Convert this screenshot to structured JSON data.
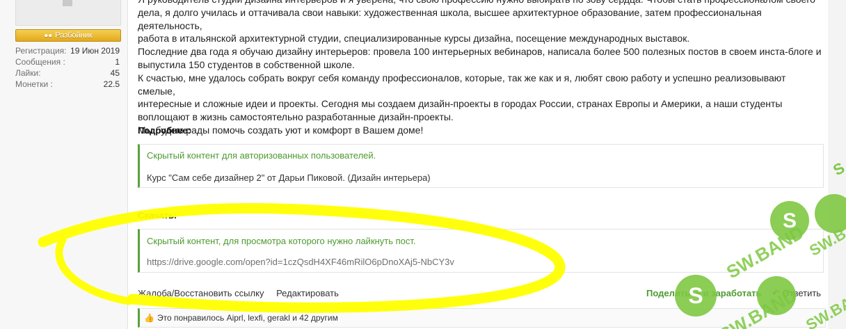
{
  "user": {
    "rank": "Разбойник",
    "stats": [
      {
        "label": "Регистрация:",
        "value": "19 Июн 2019"
      },
      {
        "label": "Сообщения :",
        "value": "1"
      },
      {
        "label": "Лайки:",
        "value": "45"
      },
      {
        "label": "Монетки :",
        "value": "22.5"
      }
    ]
  },
  "post": {
    "lines": [
      "Я руководитель студии дизайна интерьеров и я уверена, что свою профессию нужно выбирать по зову сердца. Чтобы стать профессионалом своего",
      "дела, я долго училась и оттачивала свои навыки: художественная школа, высшее архитектурное образование, затем профессиональная деятельность,",
      "работа в итальянской архитектурной студии, специализированные курсы дизайна, посещение международных выставок.",
      "Последние два года я обучаю дизайну интерьеров: провела 100 интерьерных вебинаров, написала более 500 полезных постов в своем инста-блоге и",
      "выпустила 150 студентов в собственной школе.",
      "К счастью, мне удалось собрать вокруг себя команду профессионалов, которые, так же как и я, любят свою работу и успешно реализовывают смелые,",
      "интересные и сложные идеи и проекты. Сегодня мы создаем дизайн-проекты в городах России, странах Европы и Америки, а наши студенты",
      "воплощают в жизнь самостоятельно разработанные дизайн-проекты.",
      "Мы будем рады помочь создать уют и комфорт в Вашем доме!"
    ],
    "details_heading": "Подробнее:",
    "hidden_auth": "Скрытый контент для авторизованных пользователей.",
    "course_title": "Курс \"Сам себе дизайнер 2\" от Дарьи Пиковой. (Дизайн интерьера)",
    "download_heading": "Скачать:",
    "hidden_like": "Скрытый контент, для просмотра которого нужно лайкнуть пост.",
    "download_link": "https://drive.google.com/open?id=1czQsdH4XF46mRilO6pDnoXAj5-NbCY3v"
  },
  "actions": {
    "report": "Жалоба/Восстановить ссылку",
    "edit": "Редактировать",
    "share": "Поделиться и заработать",
    "reply": "Ответить"
  },
  "likes": {
    "text": "Это понравилось Aiprl, lexfi, gerakl и 42 другим"
  },
  "watermark": {
    "text": "SW.BAND"
  },
  "colors": {
    "accent_green": "#4c9a2f",
    "highlight": "#ffff00",
    "rank_gold": "#e3a91c"
  }
}
